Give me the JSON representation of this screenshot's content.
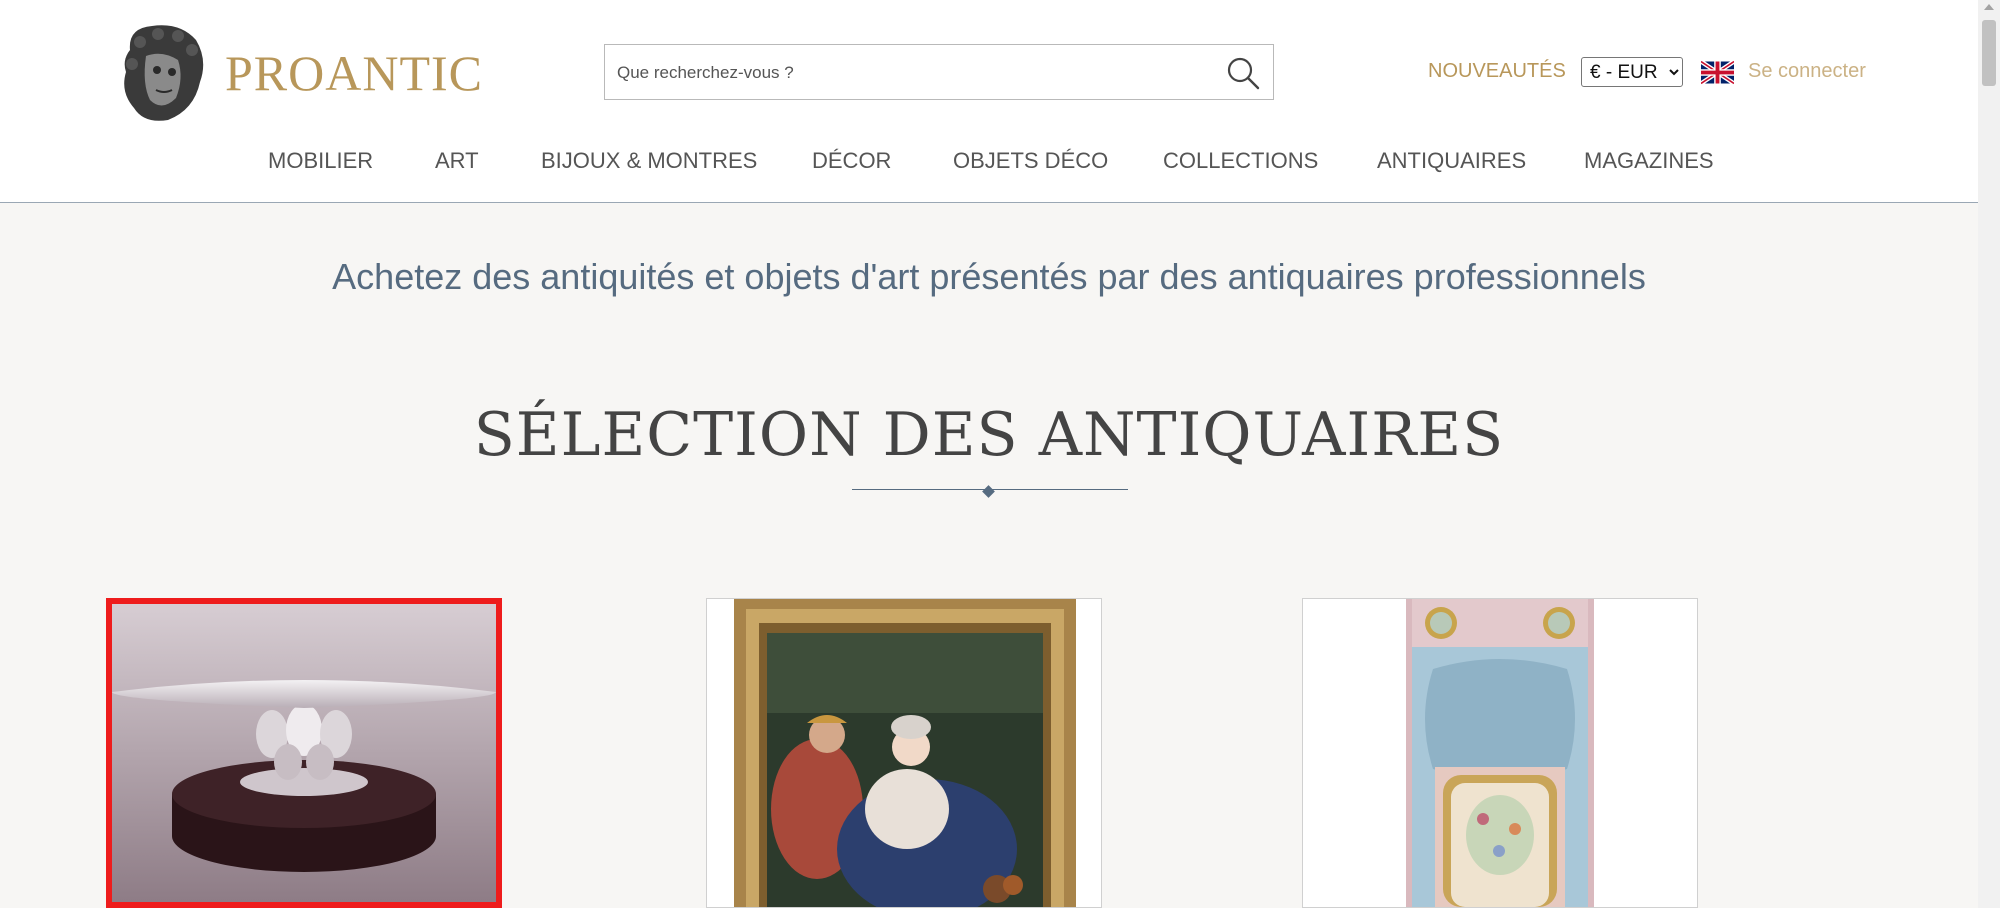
{
  "header": {
    "brand": "PROANTIC",
    "search": {
      "placeholder": "Que recherchez-vous ?"
    },
    "nouveautes": "NOUVEAUTÉS",
    "currency": {
      "selected": "€ - EUR",
      "options": [
        "€ - EUR"
      ]
    },
    "login": "Se connecter"
  },
  "nav": {
    "items": [
      {
        "label": "MOBILIER"
      },
      {
        "label": "ART"
      },
      {
        "label": "BIJOUX & MONTRES"
      },
      {
        "label": "DÉCOR"
      },
      {
        "label": "OBJETS DÉCO"
      },
      {
        "label": "COLLECTIONS"
      },
      {
        "label": "ANTIQUAIRES"
      },
      {
        "label": "MAGAZINES"
      }
    ]
  },
  "main": {
    "tagline": "Achetez des antiquités et objets d'art présentés par des antiquaires professionnels",
    "section_title": "SÉLECTION DES ANTIQUAIRES"
  },
  "colors": {
    "brand_gold": "#b8975a",
    "accent_blue": "#566b80",
    "selection_red": "#ee1c1c",
    "background": "#f7f6f4"
  },
  "icons": [
    "logo-icon",
    "search-icon",
    "uk-flag-icon"
  ]
}
